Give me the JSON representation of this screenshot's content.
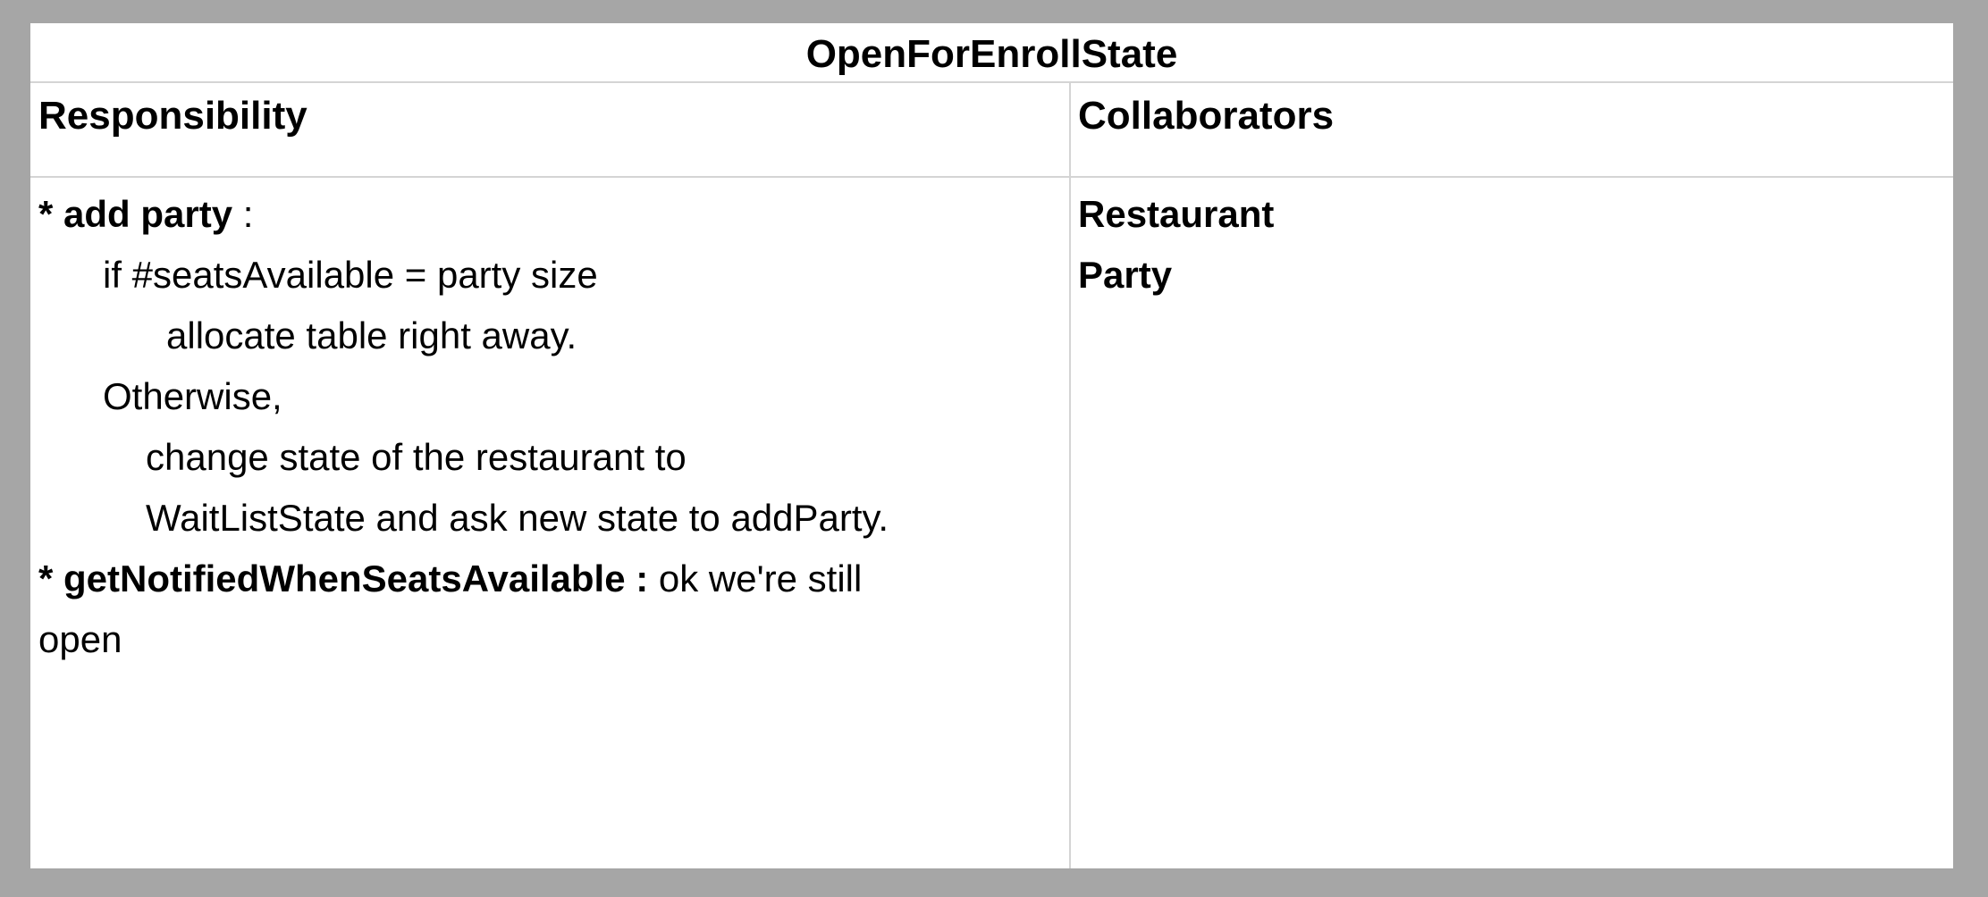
{
  "card": {
    "title": "OpenForEnrollState",
    "responsibility_header": "Responsibility",
    "collaborators_header": "Collaborators",
    "responsibilities": {
      "r1_bullet": "* add party",
      "r1_colon": " :",
      "r1_l1": "if #seatsAvailable = party size",
      "r1_l2": "allocate table right away.",
      "r1_l3": "Otherwise,",
      "r1_l4": "change state of the restaurant to",
      "r1_l5": "WaitListState and ask new state to addParty.",
      "r2_bullet": "* getNotifiedWhenSeatsAvailable :",
      "r2_text": " ok we're still",
      "r2_cont": "open"
    },
    "collaborators": [
      "Restaurant",
      "Party"
    ]
  }
}
